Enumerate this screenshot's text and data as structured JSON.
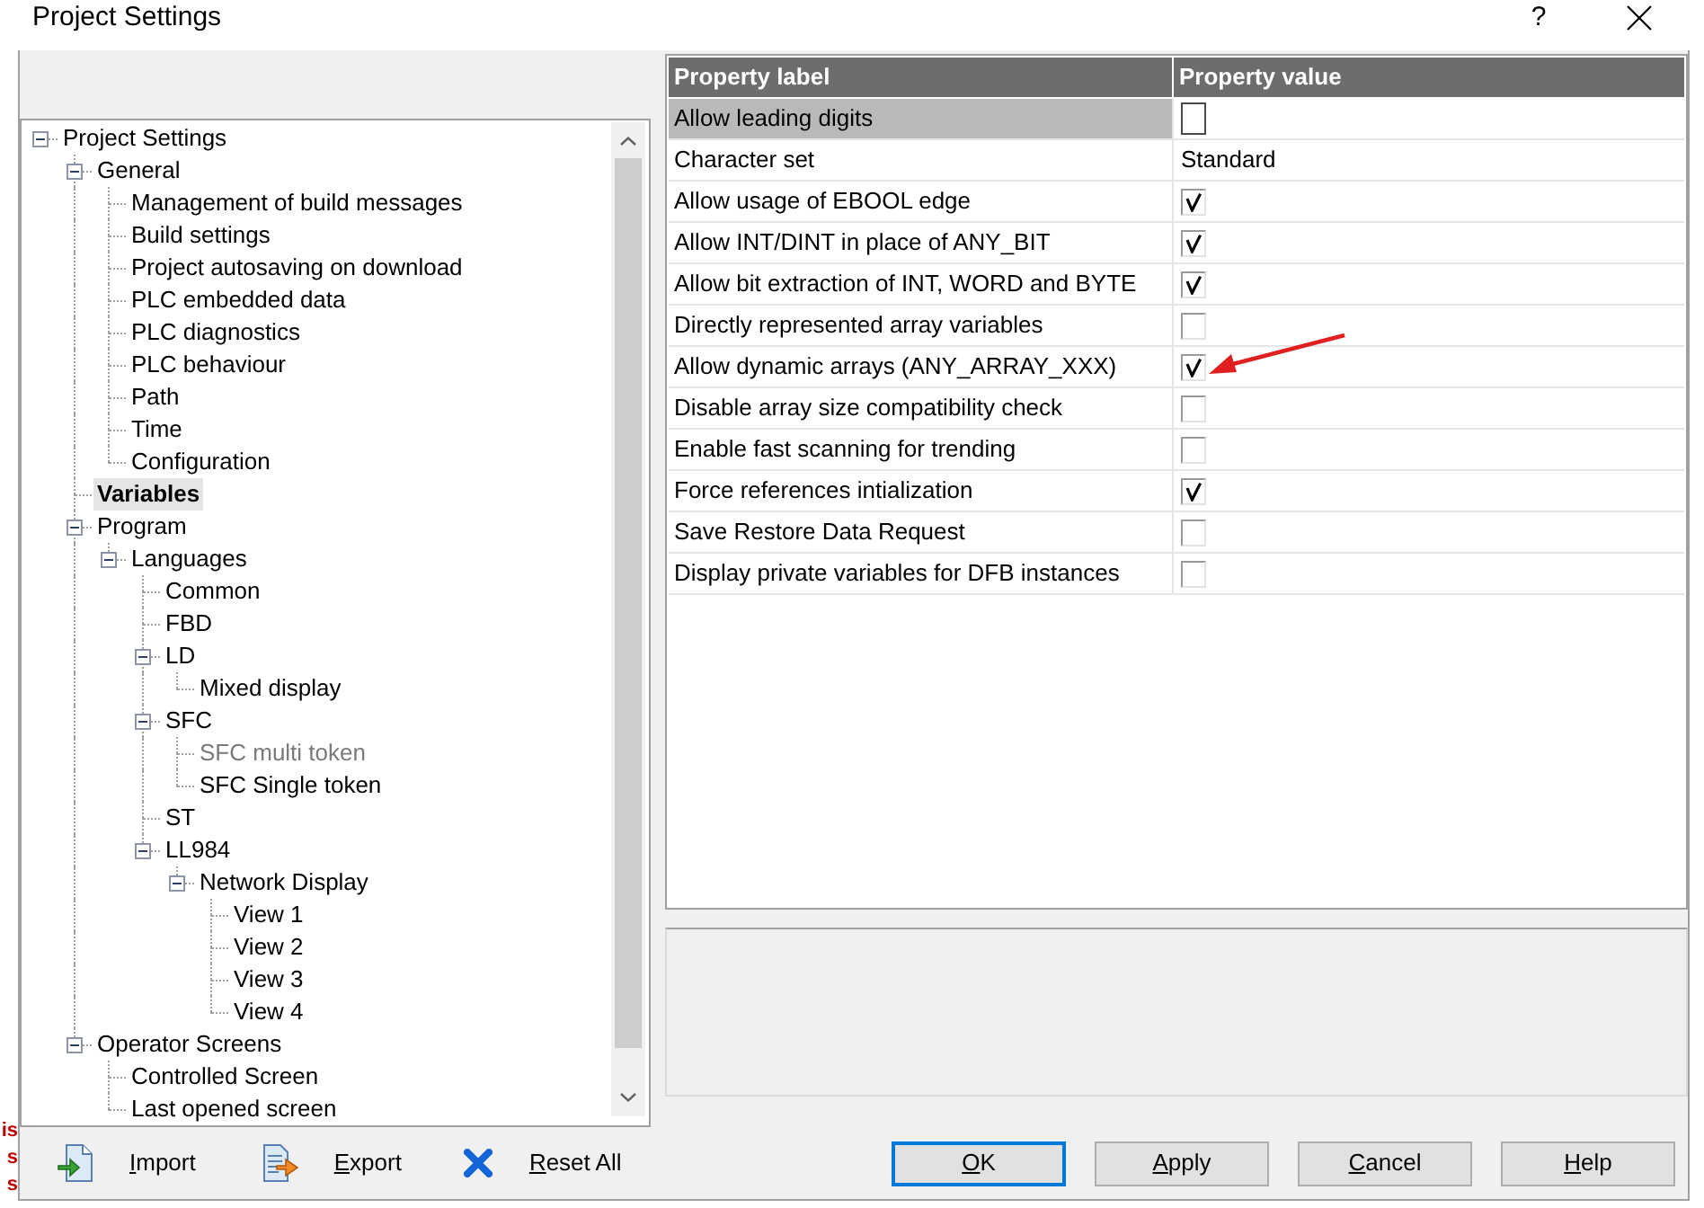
{
  "window": {
    "title": "Project Settings",
    "help": "?"
  },
  "background_window": {
    "fragments": [
      "is",
      "s",
      "s"
    ]
  },
  "tree": {
    "items": [
      {
        "label": "Project Settings",
        "expanded": true,
        "selected": false,
        "disabled": false,
        "children": [
          {
            "label": "General",
            "expanded": true,
            "selected": false,
            "disabled": false,
            "children": [
              {
                "label": "Management of build messages",
                "selected": false,
                "disabled": false
              },
              {
                "label": "Build settings",
                "selected": false,
                "disabled": false
              },
              {
                "label": "Project autosaving on download",
                "selected": false,
                "disabled": false
              },
              {
                "label": "PLC embedded data",
                "selected": false,
                "disabled": false
              },
              {
                "label": "PLC diagnostics",
                "selected": false,
                "disabled": false
              },
              {
                "label": "PLC behaviour",
                "selected": false,
                "disabled": false
              },
              {
                "label": "Path",
                "selected": false,
                "disabled": false
              },
              {
                "label": "Time",
                "selected": false,
                "disabled": false
              },
              {
                "label": "Configuration",
                "selected": false,
                "disabled": false
              }
            ]
          },
          {
            "label": "Variables",
            "selected": true,
            "disabled": false
          },
          {
            "label": "Program",
            "expanded": true,
            "selected": false,
            "disabled": false,
            "children": [
              {
                "label": "Languages",
                "expanded": true,
                "selected": false,
                "disabled": false,
                "children": [
                  {
                    "label": "Common",
                    "selected": false,
                    "disabled": false
                  },
                  {
                    "label": "FBD",
                    "selected": false,
                    "disabled": false
                  },
                  {
                    "label": "LD",
                    "expanded": true,
                    "selected": false,
                    "disabled": false,
                    "children": [
                      {
                        "label": "Mixed display",
                        "selected": false,
                        "disabled": false
                      }
                    ]
                  },
                  {
                    "label": "SFC",
                    "expanded": true,
                    "selected": false,
                    "disabled": false,
                    "children": [
                      {
                        "label": "SFC multi token",
                        "selected": false,
                        "disabled": true
                      },
                      {
                        "label": "SFC Single token",
                        "selected": false,
                        "disabled": false
                      }
                    ]
                  },
                  {
                    "label": "ST",
                    "selected": false,
                    "disabled": false
                  },
                  {
                    "label": "LL984",
                    "expanded": true,
                    "selected": false,
                    "disabled": false,
                    "children": [
                      {
                        "label": "Network Display",
                        "expanded": true,
                        "selected": false,
                        "disabled": false,
                        "children": [
                          {
                            "label": "View 1",
                            "selected": false,
                            "disabled": false
                          },
                          {
                            "label": "View 2",
                            "selected": false,
                            "disabled": false
                          },
                          {
                            "label": "View 3",
                            "selected": false,
                            "disabled": false
                          },
                          {
                            "label": "View 4",
                            "selected": false,
                            "disabled": false
                          }
                        ]
                      }
                    ]
                  }
                ]
              }
            ]
          },
          {
            "label": "Operator Screens",
            "expanded": true,
            "selected": false,
            "disabled": false,
            "children": [
              {
                "label": "Controlled Screen",
                "selected": false,
                "disabled": false
              },
              {
                "label": "Last opened screen",
                "selected": false,
                "disabled": false
              }
            ]
          }
        ]
      }
    ]
  },
  "properties": {
    "columns": [
      "Property label",
      "Property value"
    ],
    "rows": [
      {
        "label": "Allow leading digits",
        "kind": "checkbox",
        "checked": false,
        "selected": true
      },
      {
        "label": "Character set",
        "kind": "text",
        "value": "Standard",
        "selected": false
      },
      {
        "label": "Allow usage of EBOOL edge",
        "kind": "checkbox",
        "checked": true,
        "selected": false
      },
      {
        "label": "Allow INT/DINT in place of ANY_BIT",
        "kind": "checkbox",
        "checked": true,
        "selected": false
      },
      {
        "label": "Allow bit extraction of INT, WORD and BYTE",
        "kind": "checkbox",
        "checked": true,
        "selected": false
      },
      {
        "label": "Directly represented array variables",
        "kind": "checkbox",
        "checked": false,
        "selected": false
      },
      {
        "label": "Allow dynamic arrays (ANY_ARRAY_XXX)",
        "kind": "checkbox",
        "checked": true,
        "selected": false
      },
      {
        "label": "Disable array size compatibility check",
        "kind": "checkbox",
        "checked": false,
        "selected": false
      },
      {
        "label": "Enable fast scanning for trending",
        "kind": "checkbox",
        "checked": false,
        "selected": false
      },
      {
        "label": "Force references intialization",
        "kind": "checkbox",
        "checked": true,
        "selected": false
      },
      {
        "label": "Save Restore Data Request",
        "kind": "checkbox",
        "checked": false,
        "selected": false
      },
      {
        "label": "Display private variables for DFB instances",
        "kind": "checkbox",
        "checked": false,
        "selected": false
      }
    ]
  },
  "tools": [
    {
      "kind": "import",
      "label": "Import",
      "access_key": true
    },
    {
      "kind": "export",
      "label": "Export",
      "access_key": true
    },
    {
      "kind": "reset",
      "label": "Reset All",
      "access_key": true
    }
  ],
  "buttons": [
    {
      "label": "OK",
      "default": true,
      "access_key": true
    },
    {
      "label": "Apply",
      "default": false,
      "access_key": true
    },
    {
      "label": "Cancel",
      "default": false,
      "access_key": true
    },
    {
      "label": "Help",
      "default": false,
      "access_key": true
    }
  ]
}
